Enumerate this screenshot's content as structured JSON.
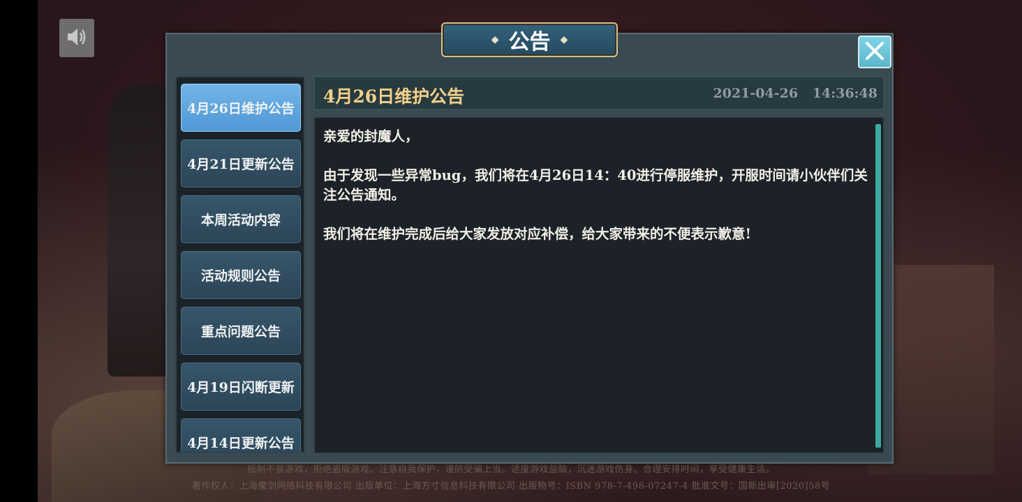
{
  "title": "公告",
  "close_label": "✕",
  "tabs": [
    {
      "label": "4月26日维护公告",
      "active": true
    },
    {
      "label": "4月21日更新公告",
      "active": false
    },
    {
      "label": "本周活动内容",
      "active": false
    },
    {
      "label": "活动规则公告",
      "active": false
    },
    {
      "label": "重点问题公告",
      "active": false
    },
    {
      "label": "4月19日闪断更新",
      "active": false
    },
    {
      "label": "4月14日更新公告",
      "active": false
    }
  ],
  "notice": {
    "title": "4月26日维护公告",
    "date": "2021-04-26 14:36:48",
    "paragraphs": [
      "亲爱的封魔人，",
      "由于发现一些异常bug，我们将在4月26日14：40进行停服维护，开服时间请小伙伴们关注公告通知。",
      "我们将在维护完成后给大家发放对应补偿，给大家带来的不便表示歉意!"
    ]
  },
  "footer": {
    "line1": "抵制不良游戏，拒绝盗版游戏。注意自我保护，谨防受骗上当。适度游戏益脑，沉迷游戏伤身。合理安排时间，享受健康生活。",
    "line2": "著作权人：上海魔剑网络科技有限公司   出版单位：上海方寸信息科技有限公司   出版物号：ISBN 978-7-498-07247-4   批准文号：国新出审[2020]58号"
  },
  "icons": {
    "sound": "speaker-icon",
    "close": "close-icon"
  },
  "colors": {
    "accent_title": "#f4d08a",
    "active_tab": "#5fa6de",
    "scrollbar": "#3fa89e"
  }
}
